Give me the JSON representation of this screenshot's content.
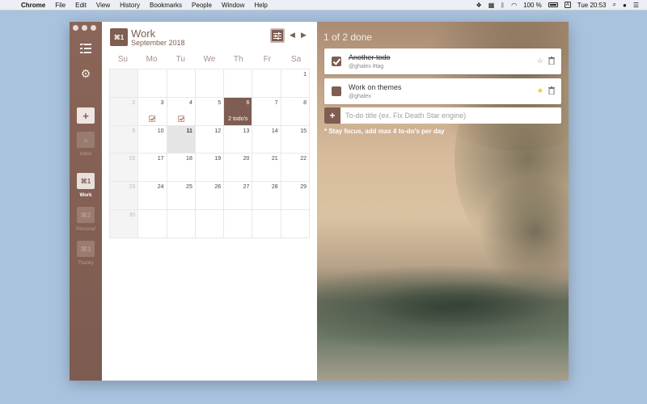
{
  "menubar": {
    "app": "Chrome",
    "menus": [
      "File",
      "Edit",
      "View",
      "History",
      "Bookmarks",
      "People",
      "Window",
      "Help"
    ],
    "battery": "100 %",
    "input_source": "A",
    "clock": "Tue 20:53"
  },
  "sidebar": {
    "settings_icon": "gear-icon",
    "add_label": "+",
    "inbox": {
      "label": "Inbox",
      "icon": "inbox-icon"
    },
    "lists": [
      {
        "shortcut": "⌘1",
        "label": "Work",
        "active": true
      },
      {
        "shortcut": "⌘2",
        "label": "Personal",
        "active": false
      },
      {
        "shortcut": "⌘3",
        "label": "Thanky",
        "active": false
      }
    ]
  },
  "calendar": {
    "badge": "⌘1",
    "title": "Work",
    "subtitle": "September 2018",
    "prev_label": "◀",
    "next_label": "▶",
    "weekdays": [
      "Su",
      "Mo",
      "Tu",
      "We",
      "Th",
      "Fr",
      "Sa"
    ],
    "weeks": [
      [
        "",
        "",
        "",
        "",
        "",
        "",
        "1"
      ],
      [
        "2",
        "3",
        "4",
        "5",
        "6",
        "7",
        "8"
      ],
      [
        "9",
        "10",
        "11",
        "12",
        "13",
        "14",
        "15"
      ],
      [
        "16",
        "17",
        "18",
        "19",
        "20",
        "21",
        "22"
      ],
      [
        "23",
        "24",
        "25",
        "26",
        "27",
        "28",
        "29"
      ],
      [
        "30",
        "",
        "",
        "",
        "",
        "",
        ""
      ]
    ],
    "today": "11",
    "selected": "6",
    "selected_label": "2 todo's",
    "checked_days": [
      "3",
      "4"
    ]
  },
  "todos": {
    "status": "1 of 2 done",
    "items": [
      {
        "title": "Another todo",
        "meta": "@ghalex #tag",
        "done": true,
        "starred": false
      },
      {
        "title": "Work on themes",
        "meta": "@ghalex",
        "done": false,
        "starred": true
      }
    ],
    "add_label": "+",
    "input_placeholder": "To-do title (ex. Fix Death Star engine)",
    "hint": "* Stay focus, add max 4 to-do's per day"
  },
  "colors": {
    "brand": "#7f5d52",
    "star": "#f2c224",
    "desktop": "#a9c3df"
  }
}
